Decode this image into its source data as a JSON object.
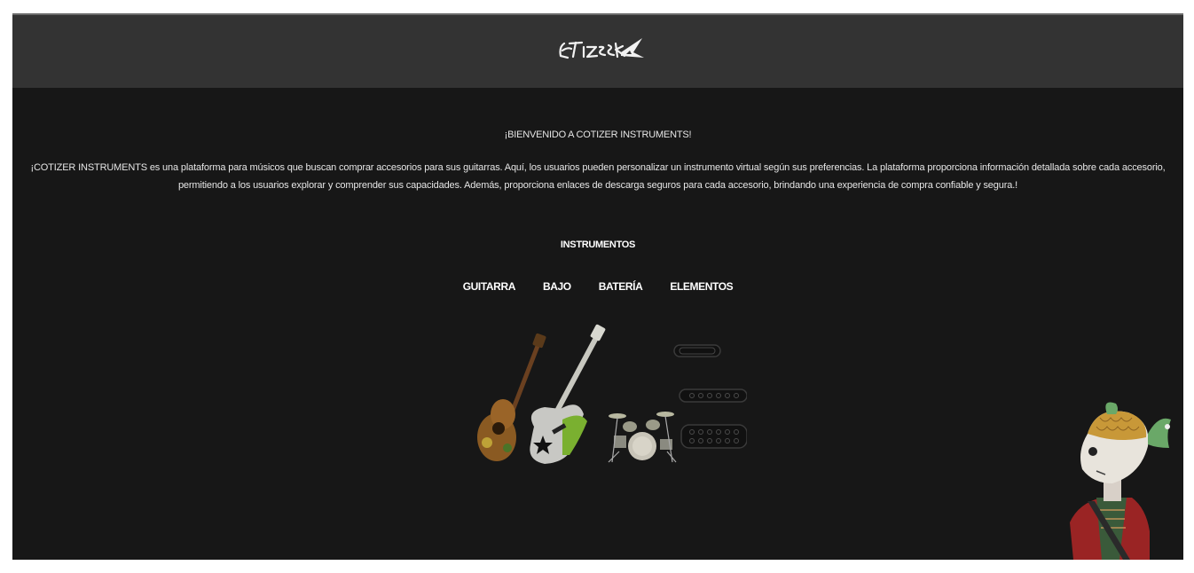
{
  "header": {
    "logo_icon": "cotizer-shark-logo"
  },
  "welcome": {
    "title": "¡BIENVENIDO A COTIZER INSTRUMENTS!",
    "description": "¡COTIZER INSTRUMENTS es una plataforma para músicos que buscan comprar accesorios para sus guitarras. Aquí, los usuarios pueden personalizar un instrumento virtual según sus preferencias. La plataforma proporciona información detallada sobre cada accesorio, permitiendo a los usuarios explorar y comprender sus capacidades. Además, proporciona enlaces de descarga seguros para cada accesorio, brindando una experiencia de compra confiable y segura.!"
  },
  "instruments": {
    "title": "INSTRUMENTOS",
    "nav": [
      "GUITARRA",
      "BAJO",
      "BATERÍA",
      "ELEMENTOS"
    ],
    "image_icon": "instruments-collage-image"
  },
  "mascot": {
    "icon": "fish-head-mascot"
  },
  "colors": {
    "page_bg": "#171717",
    "header_bg": "#333333",
    "text": "#e6e6e6"
  }
}
